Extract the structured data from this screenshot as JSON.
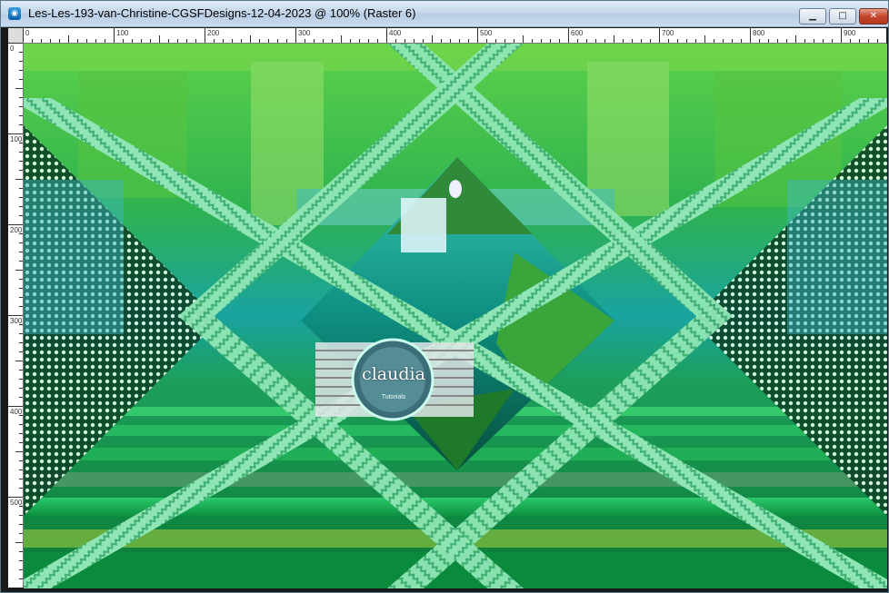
{
  "window": {
    "title": "Les-Les-193-van-Christine-CGSFDesigns-12-04-2023 @ 100% (Raster 6)",
    "buttons": {
      "minimize": "▁",
      "maximize": "□",
      "close": "✕"
    }
  },
  "ruler": {
    "horizontal": [
      "0",
      "100",
      "200",
      "300",
      "400",
      "500",
      "600",
      "700",
      "800",
      "900"
    ],
    "vertical": [
      "0",
      "100",
      "200",
      "300",
      "400",
      "500"
    ]
  },
  "watermark": {
    "text": "claudia",
    "subtext": "Tutorials"
  },
  "colors": {
    "accent": "#2ec46a",
    "mint": "#a7f0c4"
  }
}
